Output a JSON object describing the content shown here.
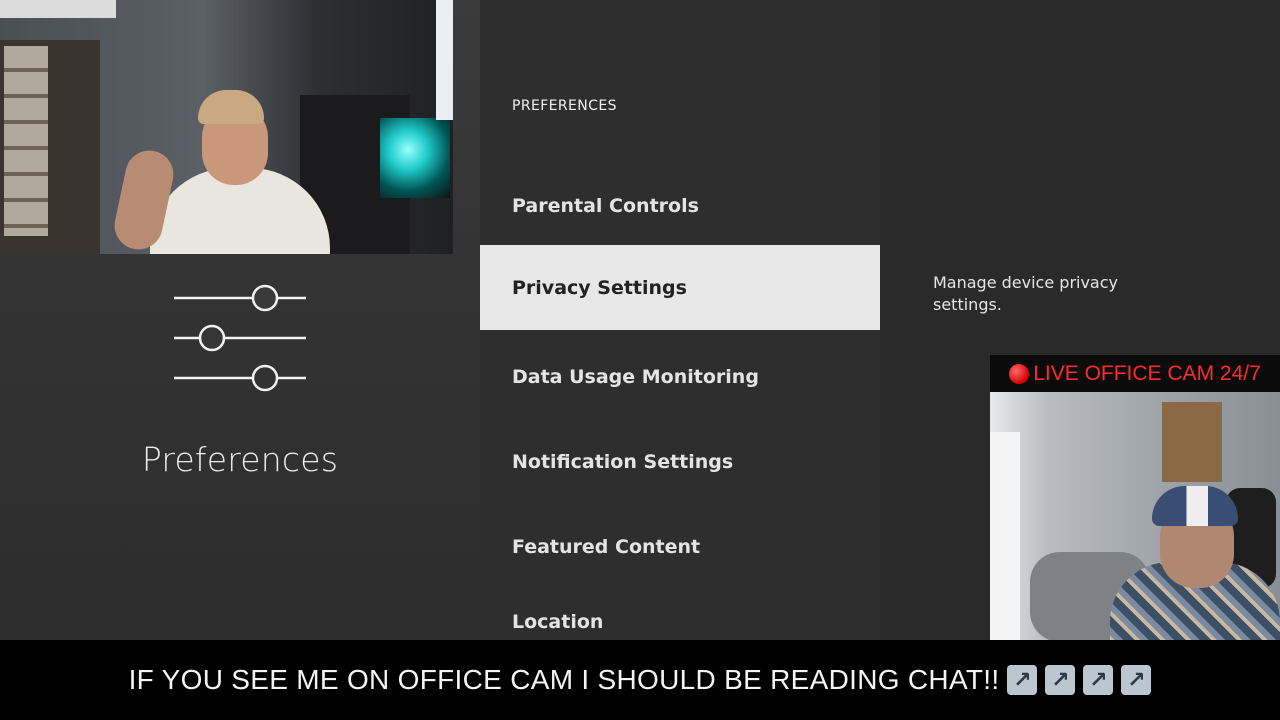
{
  "sidebar": {
    "category_icon": "sliders-icon",
    "category_title": "Preferences"
  },
  "menu": {
    "header": "PREFERENCES",
    "items": [
      {
        "label": "Parental Controls",
        "selected": false
      },
      {
        "label": "Privacy Settings",
        "selected": true
      },
      {
        "label": "Data Usage Monitoring",
        "selected": false
      },
      {
        "label": "Notification Settings",
        "selected": false
      },
      {
        "label": "Featured Content",
        "selected": false
      },
      {
        "label": "Location",
        "selected": false
      }
    ]
  },
  "detail": {
    "description": "Manage device privacy settings."
  },
  "overlay": {
    "live_banner": "LIVE OFFICE CAM 24/7",
    "live_color": "#ff2b2b",
    "ticker_text": "IF YOU SEE ME ON OFFICE CAM I SHOULD BE READING CHAT!!",
    "ticker_arrows": [
      "↗",
      "↗",
      "↗",
      "↗"
    ]
  },
  "colors": {
    "selected_bg": "#e7e7e7",
    "panel_bg": "#2e2e2e"
  }
}
